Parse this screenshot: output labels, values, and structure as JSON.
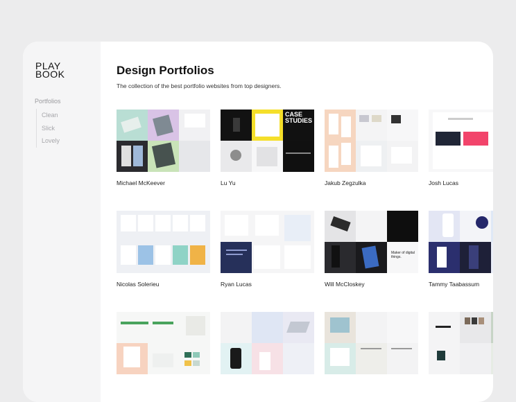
{
  "brand": {
    "line1": "PLAY",
    "line2": "BOOK"
  },
  "sidebar": {
    "heading": "Portfolios",
    "items": [
      {
        "label": "Clean"
      },
      {
        "label": "Slick"
      },
      {
        "label": "Lovely"
      }
    ]
  },
  "main": {
    "title": "Design Portfolios",
    "subtitle": "The collection of the best portfolio websites from top designers.",
    "cards": [
      {
        "name": "Michael McKeever"
      },
      {
        "name": "Lu Yu"
      },
      {
        "name": "Jakub Zegzulka"
      },
      {
        "name": "Josh Lucas"
      },
      {
        "name": "Nicolas Solerieu"
      },
      {
        "name": "Ryan Lucas"
      },
      {
        "name": "Will McCloskey"
      },
      {
        "name": "Tammy Taabassum"
      },
      {
        "name": ""
      },
      {
        "name": ""
      },
      {
        "name": ""
      },
      {
        "name": ""
      }
    ],
    "thumb_text": {
      "luyu_case": "CASE STUDIES",
      "will_tagline": "Maker of digital things."
    }
  },
  "colors": {
    "page_bg": "#ececed",
    "sidebar_bg": "#f5f5f6",
    "accent_yellow": "#f5df2a",
    "accent_pink": "#f2446b",
    "navy": "#26305a"
  }
}
